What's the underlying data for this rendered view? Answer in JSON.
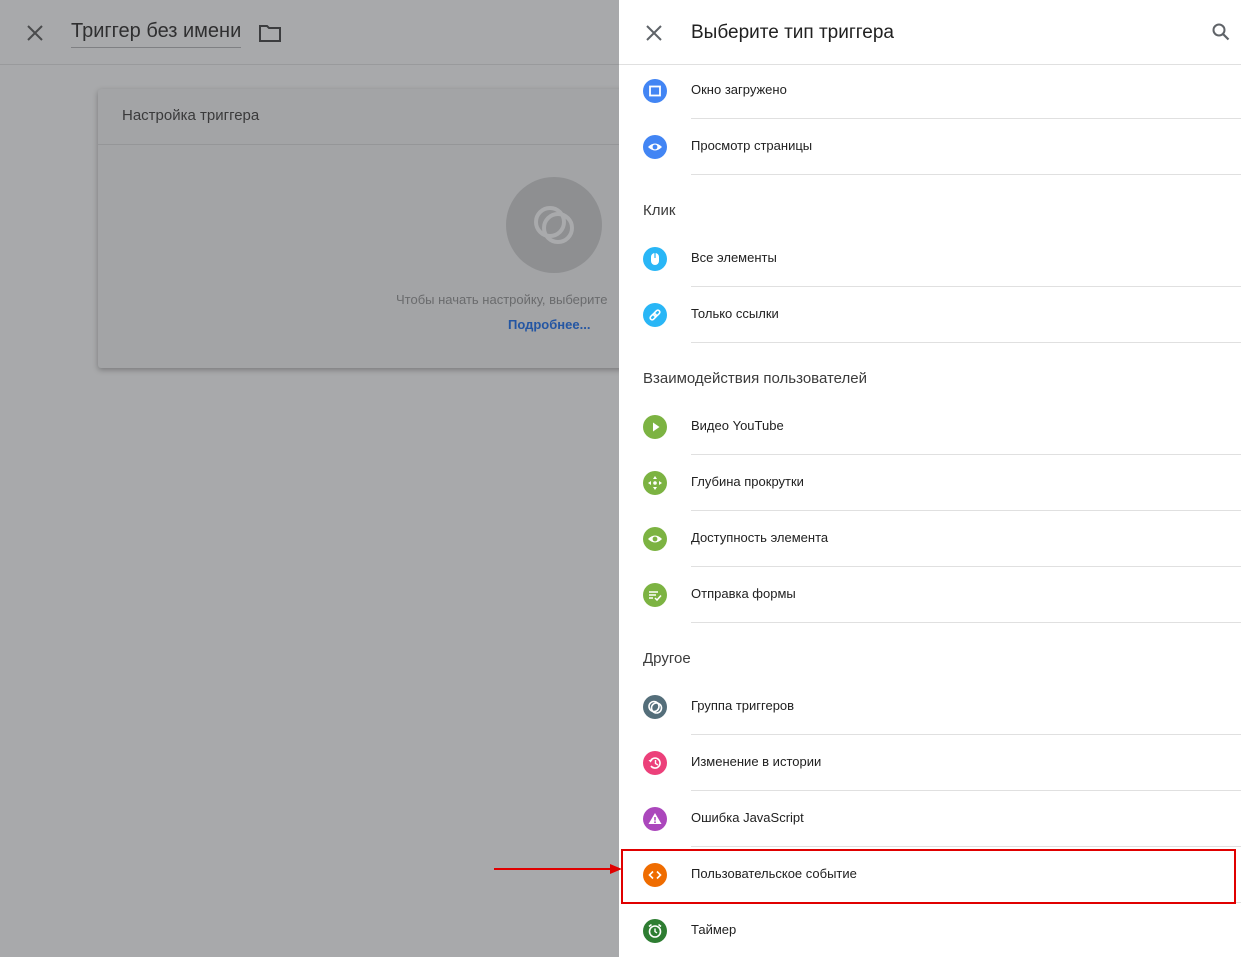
{
  "editor": {
    "title": "Триггер без имени",
    "card_title": "Настройка триггера",
    "card_hint": "Чтобы начать настройку, выберите",
    "card_link": "Подробнее..."
  },
  "panel": {
    "title": "Выберите тип триггера",
    "groups": [
      {
        "heading": "",
        "items": [
          {
            "label": "Окно загружено",
            "icon": "window-icon",
            "color": "#4285f4"
          },
          {
            "label": "Просмотр страницы",
            "icon": "eye-icon",
            "color": "#4285f4"
          }
        ]
      },
      {
        "heading": "Клик",
        "items": [
          {
            "label": "Все элементы",
            "icon": "mouse-icon",
            "color": "#29b6f6"
          },
          {
            "label": "Только ссылки",
            "icon": "link-icon",
            "color": "#29b6f6"
          }
        ]
      },
      {
        "heading": "Взаимодействия пользователей",
        "items": [
          {
            "label": "Видео YouTube",
            "icon": "play-icon",
            "color": "#7cb342"
          },
          {
            "label": "Глубина прокрутки",
            "icon": "scroll-arrows-icon",
            "color": "#7cb342"
          },
          {
            "label": "Доступность элемента",
            "icon": "eye-icon",
            "color": "#7cb342"
          },
          {
            "label": "Отправка формы",
            "icon": "form-check-icon",
            "color": "#7cb342"
          }
        ]
      },
      {
        "heading": "Другое",
        "items": [
          {
            "label": "Группа триггеров",
            "icon": "trigger-group-icon",
            "color": "#546e7a"
          },
          {
            "label": "Изменение в истории",
            "icon": "history-icon",
            "color": "#ec407a"
          },
          {
            "label": "Ошибка JavaScript",
            "icon": "warning-icon",
            "color": "#ab47bc"
          },
          {
            "label": "Пользовательское событие",
            "icon": "code-icon",
            "color": "#ef6c00"
          },
          {
            "label": "Таймер",
            "icon": "alarm-icon",
            "color": "#2e7d32"
          }
        ]
      }
    ]
  },
  "annotation": {
    "highlight_color": "#e00000",
    "highlighted_item": "Пользовательское событие"
  }
}
